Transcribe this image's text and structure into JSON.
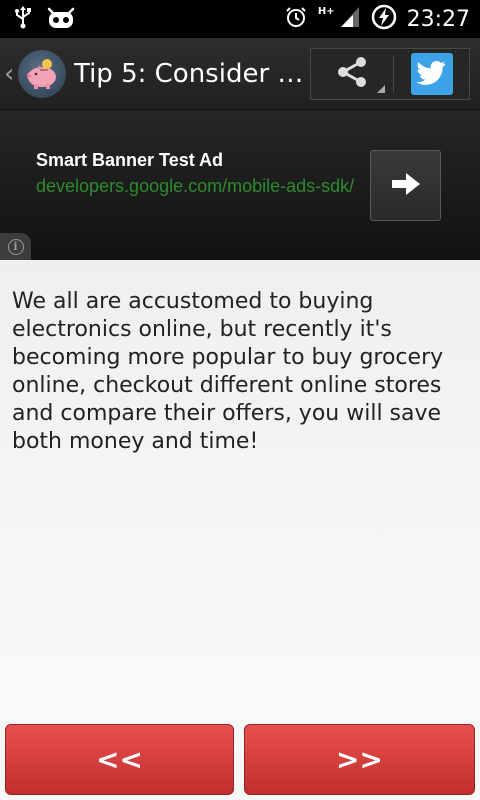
{
  "status_bar": {
    "time": "23:27",
    "network_label": "H+",
    "icons": [
      "usb-icon",
      "android-debug-icon",
      "alarm-icon",
      "signal-icon",
      "battery-charging-icon"
    ]
  },
  "action_bar": {
    "title": "Tip 5: Consider o...",
    "icons": [
      "back-chevron-icon",
      "piggy-bank-icon",
      "share-icon",
      "twitter-icon"
    ]
  },
  "ad": {
    "title": "Smart Banner Test Ad",
    "url": "developers.google.com/mobile-ads-sdk/",
    "icons": [
      "arrow-right-icon",
      "info-icon"
    ]
  },
  "content": {
    "tip_text": "We all are accustomed to buying electronics online, but recently it's becoming more popular to buy grocery online, checkout different online stores and compare their offers, you will save both money and time!"
  },
  "navigation": {
    "prev_label": "<<",
    "next_label": ">>"
  },
  "colors": {
    "accent_red": "#d63a39",
    "twitter_blue": "#3ea3e6",
    "ad_url_green": "#2e8b2e"
  }
}
